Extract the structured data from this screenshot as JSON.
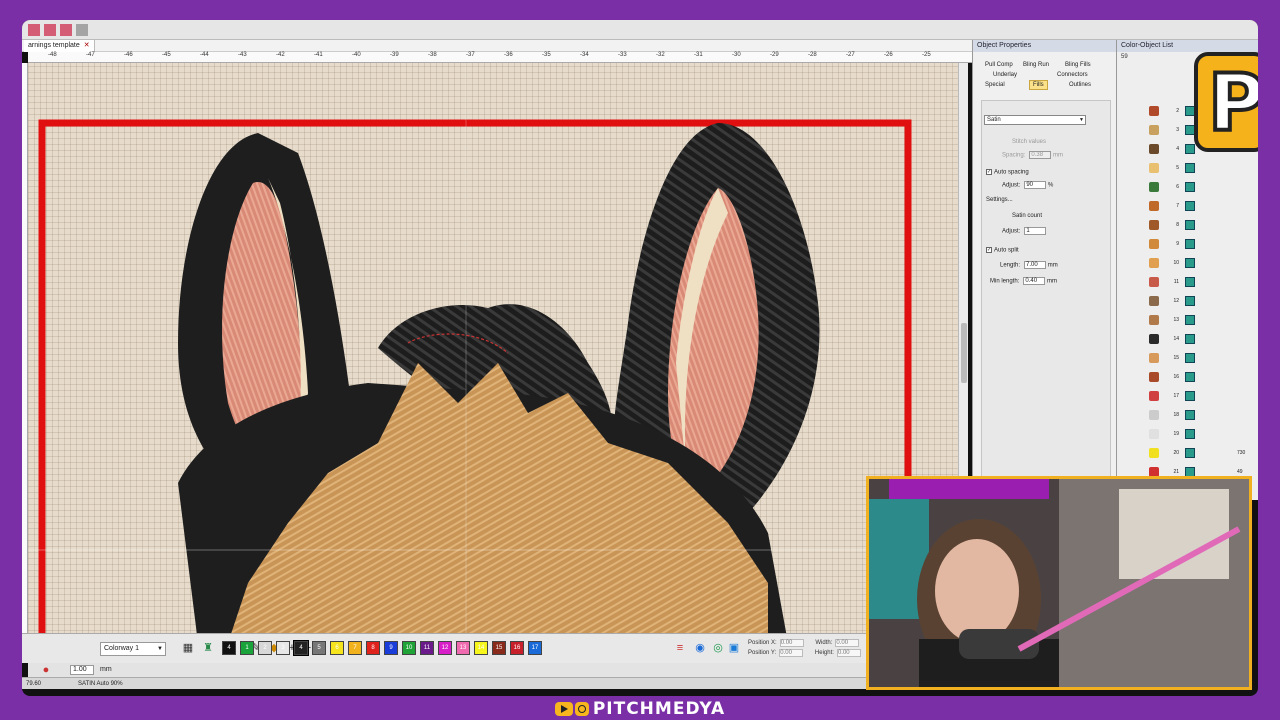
{
  "app": {
    "document_tab": "arnings template",
    "ruler_labels": [
      "-48",
      "-47",
      "-46",
      "-45",
      "-44",
      "-43",
      "-42",
      "-41",
      "-40",
      "-39",
      "-38",
      "-37",
      "-36",
      "-35",
      "-34",
      "-33",
      "-32",
      "-31",
      "-30",
      "-29",
      "-28",
      "-27",
      "-26",
      "-25"
    ]
  },
  "object_properties": {
    "title": "Object Properties",
    "tabs_row1": [
      "Pull Comp",
      "Bling Run",
      "Bling Fills"
    ],
    "tabs_row2": [
      "Underlay",
      "Connectors"
    ],
    "tabs_row3": [
      "Special",
      "Fills",
      "Outlines"
    ],
    "active_tab": "Fills",
    "fill_type": "Satin",
    "stitch_values_label": "Stitch values",
    "spacing_label": "Spacing:",
    "spacing_value": "0.38",
    "spacing_unit": "mm",
    "auto_spacing_label": "Auto spacing",
    "adjust_label": "Adjust:",
    "adjust_value": "90",
    "adjust_unit": "%",
    "settings_label": "Settings...",
    "satin_count_label": "Satin count",
    "satin_adjust_value": "1",
    "auto_split_label": "Auto split",
    "length_label": "Length:",
    "length_value": "7.00",
    "length_unit": "mm",
    "min_length_label": "Min length:",
    "min_length_value": "0.40",
    "min_length_unit": "mm"
  },
  "color_list": {
    "title": "Color-Object List",
    "header_value": "59",
    "rows": [
      "2",
      "3",
      "4",
      "5",
      "6",
      "7",
      "8",
      "9",
      "10",
      "11",
      "12",
      "13",
      "14",
      "15",
      "16",
      "17",
      "18",
      "19",
      "20",
      "21"
    ],
    "row_values": [
      "730",
      "49"
    ]
  },
  "bottom_bar": {
    "colorway": "Colorway 1",
    "swatches": [
      {
        "label": "4",
        "color": "#111111"
      },
      {
        "label": "1",
        "color": "#1aa33a"
      },
      {
        "label": "2",
        "color": "#d8d8d8"
      },
      {
        "label": "3",
        "color": "#e8e8e8"
      },
      {
        "label": "4",
        "color": "#222222"
      },
      {
        "label": "5",
        "color": "#777777"
      },
      {
        "label": "6",
        "color": "#f6e51c"
      },
      {
        "label": "7",
        "color": "#f2b21e"
      },
      {
        "label": "8",
        "color": "#e0221c"
      },
      {
        "label": "9",
        "color": "#1a3cd8"
      },
      {
        "label": "10",
        "color": "#1fa336"
      },
      {
        "label": "11",
        "color": "#6a1a8a"
      },
      {
        "label": "12",
        "color": "#d81ec8"
      },
      {
        "label": "13",
        "color": "#f06ab0"
      },
      {
        "label": "14",
        "color": "#f6f61c"
      },
      {
        "label": "15",
        "color": "#8a2a1a"
      },
      {
        "label": "16",
        "color": "#c8202a"
      },
      {
        "label": "17",
        "color": "#1a6ad8"
      }
    ],
    "position_x_label": "Position X:",
    "position_y_label": "Position Y:",
    "width_label": "Width:",
    "height_label": "Height:",
    "position_x": "0.00",
    "position_y": "0.00",
    "width": "0.00",
    "height": "0.00",
    "zoom_value": "1.00",
    "zoom_unit": "mm"
  },
  "status": {
    "coords": "79.60",
    "stitch_type": "SATIN Auto 90%"
  },
  "logo_letter": "P",
  "footer_handle": "PITCHMEDYA",
  "colors": {
    "background": "#7a2fa6",
    "hoop_red": "#e01010",
    "accent_gold": "#f0b020"
  }
}
